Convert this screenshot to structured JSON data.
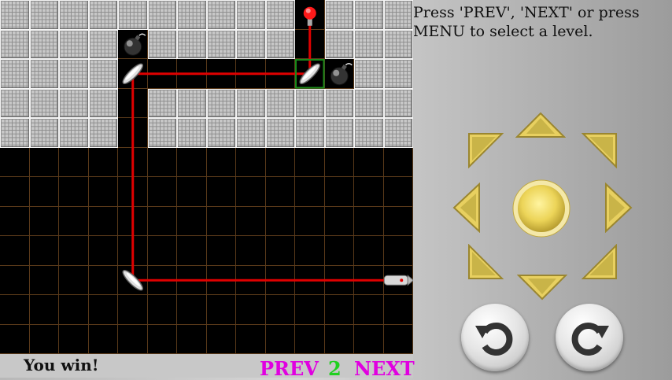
{
  "board": {
    "cols": 14,
    "rows": 12,
    "walls": [
      [
        0,
        0
      ],
      [
        1,
        0
      ],
      [
        2,
        0
      ],
      [
        3,
        0
      ],
      [
        4,
        0
      ],
      [
        5,
        0
      ],
      [
        6,
        0
      ],
      [
        7,
        0
      ],
      [
        8,
        0
      ],
      [
        9,
        0
      ],
      [
        11,
        0
      ],
      [
        12,
        0
      ],
      [
        13,
        0
      ],
      [
        0,
        1
      ],
      [
        1,
        1
      ],
      [
        2,
        1
      ],
      [
        3,
        1
      ],
      [
        5,
        1
      ],
      [
        6,
        1
      ],
      [
        7,
        1
      ],
      [
        8,
        1
      ],
      [
        9,
        1
      ],
      [
        11,
        1
      ],
      [
        12,
        1
      ],
      [
        13,
        1
      ],
      [
        0,
        2
      ],
      [
        1,
        2
      ],
      [
        2,
        2
      ],
      [
        3,
        2
      ],
      [
        12,
        2
      ],
      [
        13,
        2
      ],
      [
        0,
        3
      ],
      [
        1,
        3
      ],
      [
        2,
        3
      ],
      [
        3,
        3
      ],
      [
        5,
        3
      ],
      [
        6,
        3
      ],
      [
        7,
        3
      ],
      [
        8,
        3
      ],
      [
        9,
        3
      ],
      [
        10,
        3
      ],
      [
        11,
        3
      ],
      [
        12,
        3
      ],
      [
        13,
        3
      ],
      [
        0,
        4
      ],
      [
        1,
        4
      ],
      [
        2,
        4
      ],
      [
        3,
        4
      ],
      [
        5,
        4
      ],
      [
        6,
        4
      ],
      [
        7,
        4
      ],
      [
        8,
        4
      ],
      [
        9,
        4
      ],
      [
        10,
        4
      ],
      [
        11,
        4
      ],
      [
        12,
        4
      ],
      [
        13,
        4
      ]
    ],
    "bombs": [
      [
        4,
        1
      ],
      [
        11,
        2
      ]
    ],
    "mirrors": [
      {
        "cell": [
          4,
          2
        ],
        "orientation": "slash"
      },
      {
        "cell": [
          10,
          2
        ],
        "orientation": "slash",
        "selected": true
      },
      {
        "cell": [
          4,
          9
        ],
        "orientation": "backslash"
      }
    ],
    "emitter": {
      "cell": [
        13,
        9
      ],
      "facing": "left"
    },
    "target": {
      "cell": [
        10,
        0
      ]
    },
    "laser_path": [
      [
        13,
        9
      ],
      [
        4,
        9
      ],
      [
        4,
        2
      ],
      [
        10,
        2
      ],
      [
        10,
        0
      ]
    ],
    "colors": {
      "laser": "#e00000",
      "grid_line": "#5a3a1a",
      "selection": "#1a8a1a"
    }
  },
  "status": "You win!",
  "nav": {
    "prev_label": "PREV",
    "level": "2",
    "next_label": "NEXT"
  },
  "instructions": "Press 'PREV', 'NEXT' or press MENU to select a level.",
  "controls": {
    "dpad": [
      "up",
      "up-right",
      "right",
      "down-right",
      "down",
      "down-left",
      "left",
      "up-left",
      "center"
    ],
    "rotate_left_icon": "rotate-ccw-icon",
    "rotate_right_icon": "rotate-cw-icon",
    "accent": "#e8d060"
  }
}
